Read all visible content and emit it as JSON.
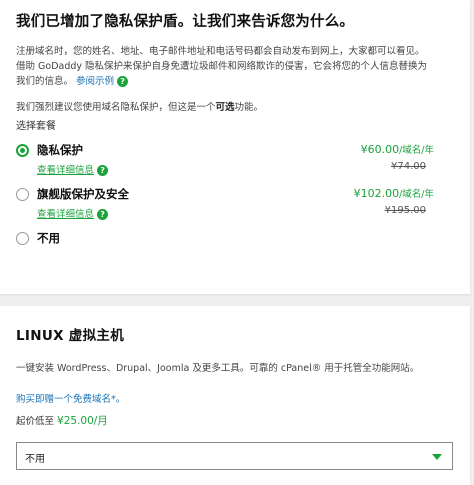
{
  "privacy": {
    "title": "我们已增加了隐私保护盾。让我们来告诉您为什么。",
    "intro_line1": "注册域名时，您的姓名、地址、电子邮件地址和电话号码都会自动发布到网上，大家都可以看见。",
    "intro_line2": "借助 GoDaddy 隐私保护来保护自身免遭垃圾邮件和网络欺诈的侵害，它会将您的个人信息替换为",
    "intro_line3": "我们的信息。",
    "example_link": "参阅示例",
    "suggest_prefix": "我们强烈建议您使用域名隐私保护，但这是一个",
    "suggest_bold": "可选",
    "suggest_suffix": "功能。",
    "choose_label": "选择套餐",
    "options": [
      {
        "label": "隐私保护",
        "details": "查看详细信息",
        "price": "¥60.00",
        "unit": "/域名/年",
        "old_price": "¥74.00",
        "selected": true
      },
      {
        "label": "旗舰版保护及安全",
        "details": "查看详细信息",
        "price": "¥102.00",
        "unit": "/域名/年",
        "old_price": "¥195.00",
        "selected": false
      },
      {
        "label": "不用",
        "selected": false
      }
    ],
    "help_icon": "?"
  },
  "hosting": {
    "title": "LINUX 虚拟主机",
    "description": "一键安装 WordPress、Drupal、Joomla 及更多工具。可靠的 cPanel® 用于托管全功能网站。",
    "promo": "购买即赠一个免费域名*。",
    "from_prefix": "起价低至 ",
    "from_price": "¥25.00/月",
    "select_value": "不用"
  },
  "colors": {
    "accent_green": "#1aa33b",
    "link_blue": "#1a73b8"
  }
}
